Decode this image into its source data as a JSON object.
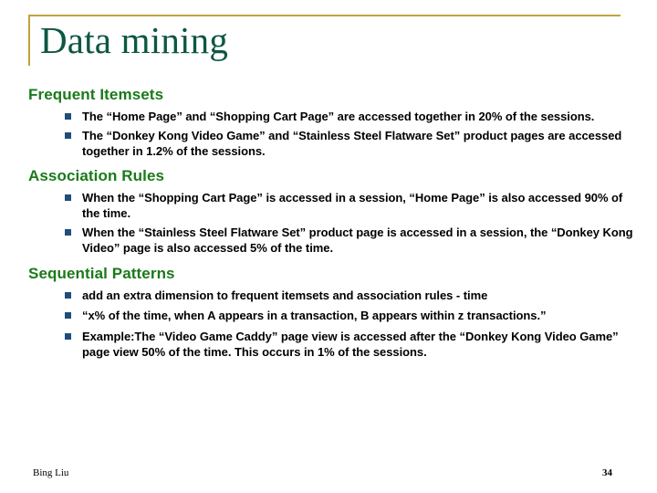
{
  "slide": {
    "title": "Data mining",
    "accent_rule_color": "#c1a33a",
    "title_color": "#0d5743",
    "heading_color": "#1a7a1a",
    "bullet_marker_color": "#1f4e79",
    "background_color": "#ffffff"
  },
  "sections": [
    {
      "heading": "Frequent Itemsets",
      "bullets": [
        "The “Home Page” and “Shopping Cart Page” are accessed together in 20% of the sessions.",
        "The “Donkey Kong Video Game” and “Stainless Steel Flatware Set” product pages are accessed together in 1.2% of the sessions."
      ]
    },
    {
      "heading": "Association Rules",
      "bullets": [
        "When the “Shopping Cart Page” is accessed in a session, “Home Page” is also accessed 90% of the time.",
        "When the “Stainless Steel Flatware Set” product page is accessed in a session, the “Donkey Kong Video” page is also accessed 5% of the time."
      ]
    },
    {
      "heading": "Sequential Patterns",
      "bullets": [
        "add an extra dimension to frequent itemsets and association rules - time",
        "“x% of the time, when A appears in a transaction, B appears within z transactions.”",
        "Example:The “Video Game Caddy” page view is accessed after the “Donkey Kong Video Game” page view 50% of the time. This occurs in 1% of the sessions."
      ]
    }
  ],
  "footer": {
    "author": "Bing Liu",
    "page_number": "34"
  }
}
